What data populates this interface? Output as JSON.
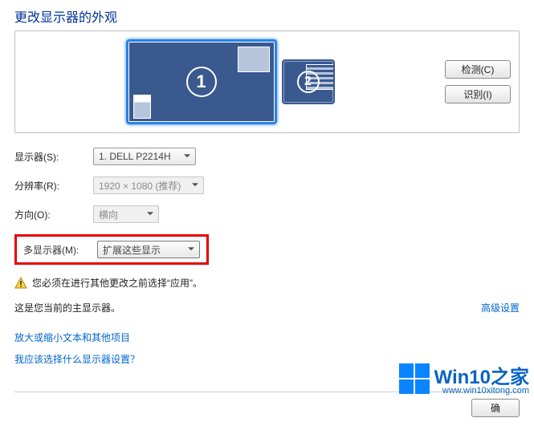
{
  "title": "更改显示器的外观",
  "arrange": {
    "monitor1_num": "1",
    "monitor2_num": "2",
    "detect_btn": "检测(C)",
    "identify_btn": "识别(I)"
  },
  "fields": {
    "display_label": "显示器(S):",
    "display_value": "1. DELL P2214H",
    "resolution_label": "分辨率(R):",
    "resolution_value": "1920 × 1080 (推荐)",
    "orientation_label": "方向(O):",
    "orientation_value": "横向",
    "multi_label": "多显示器(M):",
    "multi_value": "扩展这些显示"
  },
  "warning": "您必须在进行其他更改之前选择“应用”。",
  "main_display_text": "这是您当前的主显示器。",
  "advanced_link": "高级设置",
  "link_zoom": "放大或缩小文本和其他项目",
  "link_which": "我应该选择什么显示器设置？",
  "footer_ok": "确",
  "watermark": {
    "brand": "Win10之家",
    "url": "www.win10xitong.com"
  }
}
